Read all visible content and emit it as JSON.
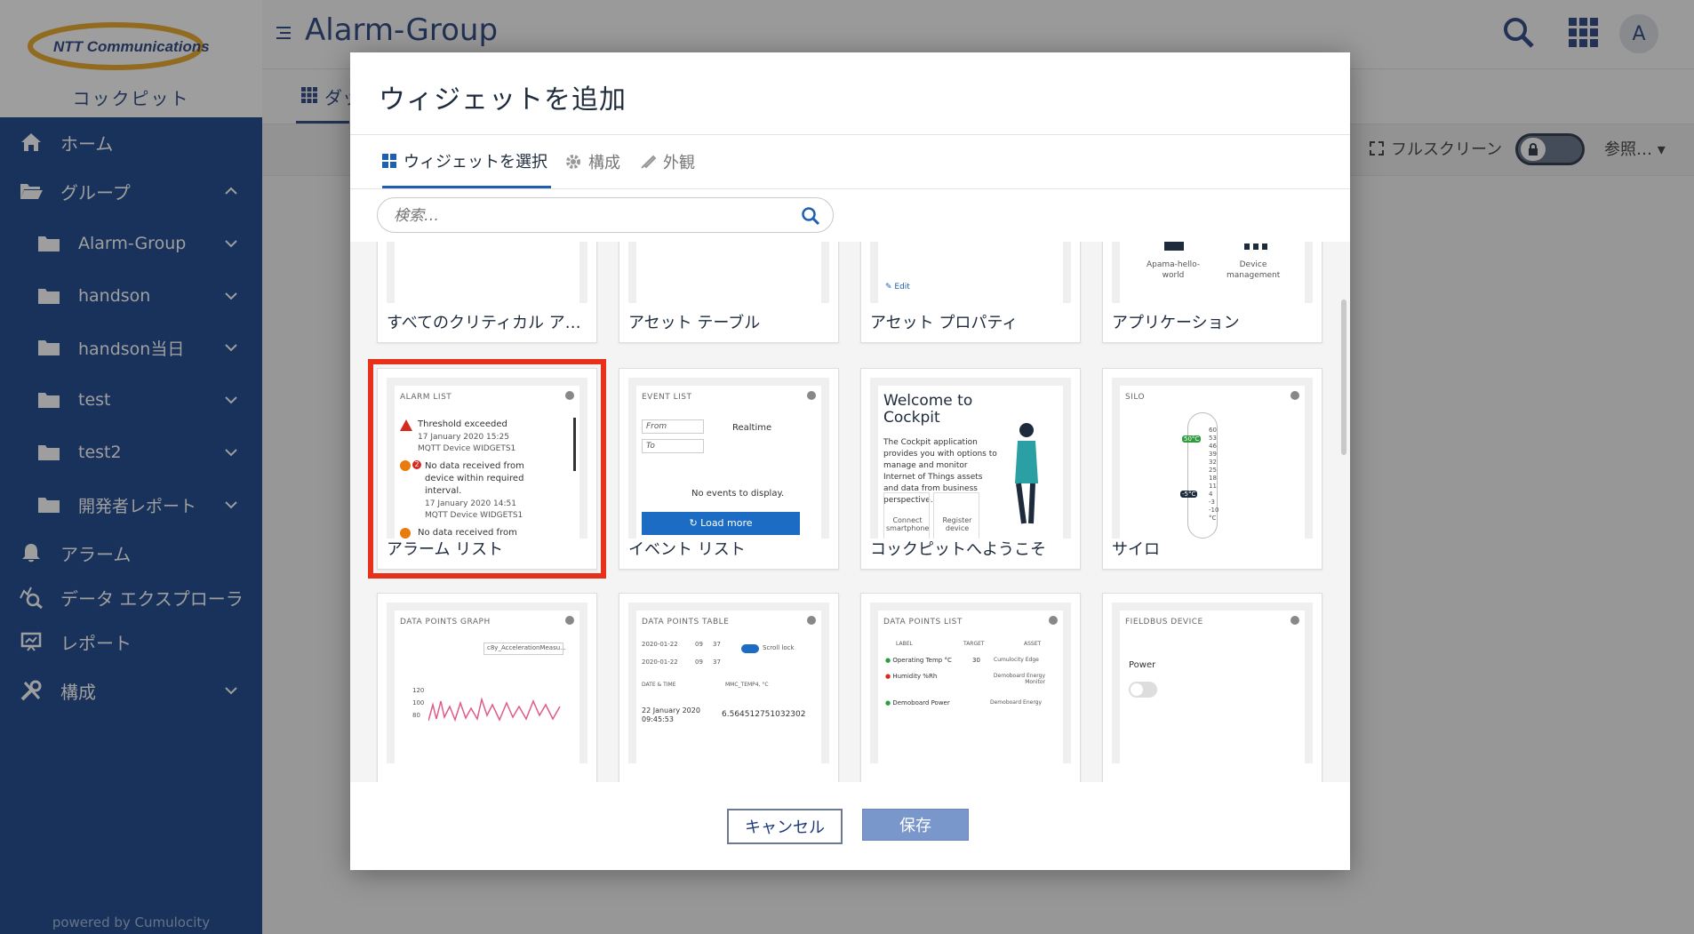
{
  "sidebar": {
    "logo_text": "NTT Communications",
    "app_name": "コックピット",
    "home": "ホーム",
    "groups": "グループ",
    "group_items": [
      "Alarm-Group",
      "handson",
      "handson当日",
      "test",
      "test2",
      "開発者レポート"
    ],
    "alarms": "アラーム",
    "explorer": "データ エクスプローラ",
    "reports": "レポート",
    "config": "構成",
    "powered": "powered by Cumulocity"
  },
  "header": {
    "title": "Alarm-Group",
    "avatar": "A",
    "tab_partial": "ダッ",
    "fullscreen": "フルスクリーン",
    "reference": "参照…"
  },
  "modal": {
    "title": "ウィジェットを追加",
    "tabs": [
      "ウィジェットを選択",
      "構成",
      "外観"
    ],
    "search_placeholder": "検索…",
    "cancel": "キャンセル",
    "save": "保存"
  },
  "widgets": {
    "row1": [
      "すべてのクリティカル ア…",
      "アセット テーブル",
      "アセット プロパティ",
      "アプリケーション"
    ],
    "row2": [
      "アラーム リスト",
      "イベント リスト",
      "コックピットへようこそ",
      "サイロ"
    ]
  },
  "previews": {
    "asset_prop_edit": "Edit",
    "app1": "Apama-hello-world",
    "app2": "Device management",
    "alarm": {
      "title": "ALARM LIST",
      "a1": "Threshold exceeded",
      "a1_time": "17 January 2020 15:25",
      "a1_dev": "MQTT Device WIDGETS1",
      "a2": "No data received from device within required interval.",
      "a2_count": "2",
      "a2_time": "17 January 2020 14:51",
      "a2_dev": "MQTT Device WIDGETS1",
      "a3": "No data received from"
    },
    "event": {
      "title": "EVENT LIST",
      "from": "From",
      "to": "To",
      "realtime": "Realtime",
      "empty": "No events to display.",
      "load": "Load more"
    },
    "welcome": {
      "title": "Welcome to Cockpit",
      "body": "The Cockpit application provides you with options to manage and monitor Internet of Things assets and data from business perspective.",
      "b1": "Connect smartphone",
      "b2": "Register device"
    },
    "silo": {
      "title": "SILO",
      "scale": [
        "60",
        "53",
        "46",
        "39",
        "32",
        "25",
        "18",
        "11",
        "4",
        "-3",
        "-10",
        "°C"
      ],
      "hi": "50°C",
      "lo": "-5°C"
    },
    "dpgraph": {
      "title": "DATA POINTS GRAPH",
      "select": "c8y_AccelerationMeasu...",
      "y": [
        "120",
        "100",
        "80"
      ]
    },
    "dptable": {
      "title": "DATA POINTS TABLE",
      "d1": "2020-01-22",
      "d2": "2020-01-22",
      "h1": "09",
      "m1": "37",
      "h2": "09",
      "m2": "37",
      "scroll": "Scroll lock",
      "col1": "DATE & TIME",
      "col2": "MMC_TEMP4, °C",
      "row_date": "22 January 2020 09:45:53",
      "row_val": "6.564512751032302"
    },
    "dplist": {
      "title": "DATA POINTS LIST",
      "c1": "LABEL",
      "c2": "TARGET",
      "c3": "ASSET",
      "r1": "Operating Temp °C",
      "r1t": "30",
      "r1a": "Cumulocity Edge",
      "r2": "Humidity %Rh",
      "r2a": "Demoboard Energy Monitor",
      "r3": "Demoboard Power",
      "r3a": "Demoboard Energy"
    },
    "fieldbus": {
      "title": "FIELDBUS DEVICE",
      "power": "Power"
    }
  },
  "colors": {
    "sidebar": "#0b3b87",
    "highlight": "#e8311a",
    "primary_button": "#1b6cc2",
    "save_button": "#7a97cc"
  }
}
